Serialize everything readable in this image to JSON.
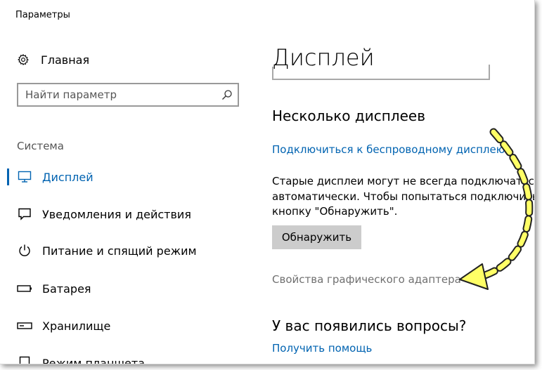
{
  "window": {
    "title": "Параметры"
  },
  "sidebar": {
    "home_label": "Главная",
    "search_placeholder": "Найти параметр",
    "section_title": "Система",
    "items": [
      {
        "label": "Дисплей",
        "icon": "monitor-icon",
        "active": true
      },
      {
        "label": "Уведомления и действия",
        "icon": "notification-icon",
        "active": false
      },
      {
        "label": "Питание и спящий режим",
        "icon": "power-icon",
        "active": false
      },
      {
        "label": "Батарея",
        "icon": "battery-icon",
        "active": false
      },
      {
        "label": "Хранилище",
        "icon": "storage-icon",
        "active": false
      },
      {
        "label": "Режим планшета",
        "icon": "tablet-icon",
        "active": false
      }
    ]
  },
  "main": {
    "page_title": "Дисплей",
    "multiple_displays": {
      "heading": "Несколько дисплеев",
      "wireless_link": "Подключиться к беспроводному дисплею",
      "description_lines": [
        "Старые дисплеи могут не всегда подключаться",
        "автоматически. Чтобы попытаться подключить",
        "кнопку \"Обнаружить\"."
      ],
      "detect_button": "Обнаружить"
    },
    "adapter_properties_link": "Свойства графического адаптера",
    "questions": {
      "heading": "У вас появились вопросы?",
      "help_link": "Получить помощь"
    }
  },
  "colors": {
    "accent": "#0063b1",
    "annotation_arrow": "#ffff66"
  }
}
